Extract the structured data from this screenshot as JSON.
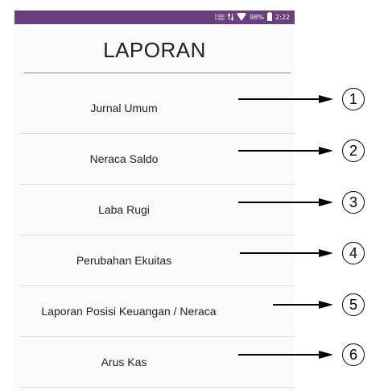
{
  "status_bar": {
    "net_up": "0 kB/s",
    "net_down": "0 kB/s",
    "battery": "98%",
    "time": "2:22",
    "icons": [
      "data-arrows-icon",
      "wifi-icon",
      "battery-icon"
    ]
  },
  "title": "LAPORAN",
  "menu": [
    {
      "label": "Jurnal Umum",
      "callout": "1"
    },
    {
      "label": "Neraca Saldo",
      "callout": "2"
    },
    {
      "label": "Laba Rugi",
      "callout": "3"
    },
    {
      "label": "Perubahan Ekuitas",
      "callout": "4"
    },
    {
      "label": "Laporan Posisi Keuangan / Neraca",
      "callout": "5"
    },
    {
      "label": "Arus Kas",
      "callout": "6"
    }
  ],
  "colors": {
    "status_bar": "#6b3f7f",
    "background": "#fafafa",
    "text": "#222222"
  }
}
